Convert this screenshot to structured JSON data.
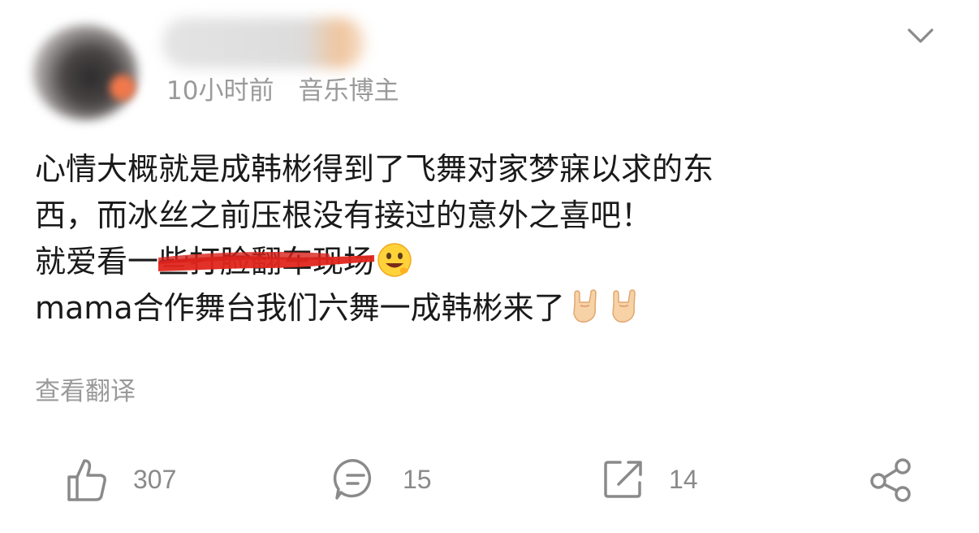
{
  "post": {
    "meta": {
      "time": "10小时前",
      "role": "音乐博主"
    },
    "text": {
      "line1": "心情大概就是成韩彬得到了飞舞对家梦寐以求的东",
      "line2": "西，而冰丝之前压根没有接过的意外之喜吧！",
      "line3_prefix": "就爱看一",
      "line3_struck": "些打脸翻车现场",
      "line4": "mama合作舞台我们六舞一成韩彬来了"
    },
    "emoji_icons": [
      "grinning-face-icon",
      "rock-on-hand-icon",
      "rock-on-hand-icon"
    ],
    "translate_label": "查看翻译"
  },
  "actions": {
    "like_count": "307",
    "comment_count": "15",
    "repost_count": "14"
  },
  "colors": {
    "text": "#1a1a1a",
    "meta": "#9a9a9a",
    "icon": "#8a8a8a",
    "strike": "#e0261c"
  }
}
